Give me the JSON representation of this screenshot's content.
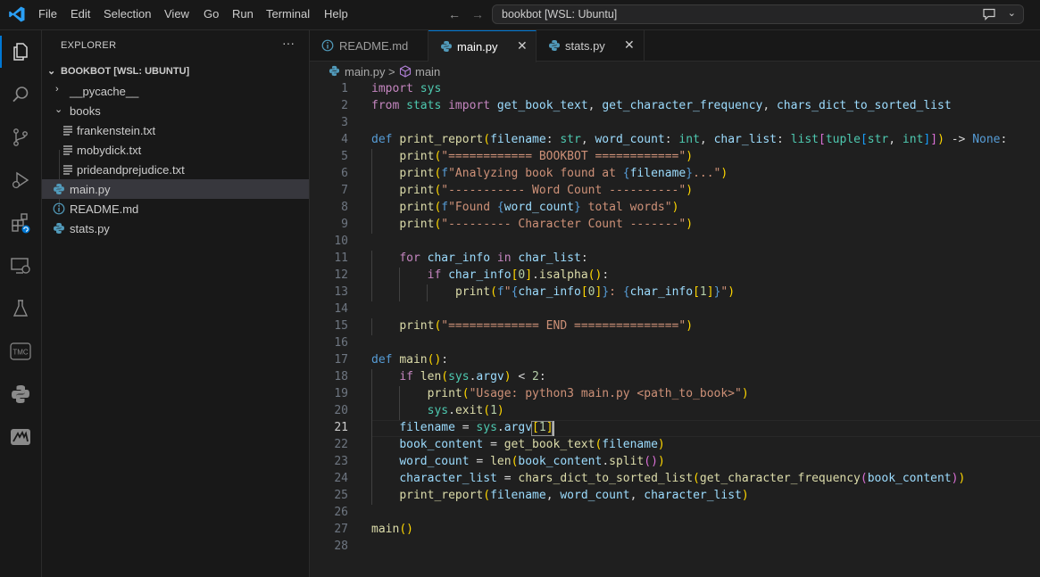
{
  "titlebar": {
    "menu": [
      "File",
      "Edit",
      "Selection",
      "View",
      "Go",
      "Run",
      "Terminal",
      "Help"
    ],
    "command_center": "bookbot [WSL: Ubuntu]"
  },
  "activity_bar": {
    "items": [
      "explorer-icon",
      "search-icon",
      "source-control-icon",
      "run-debug-icon",
      "extensions-icon",
      "remote-explorer-icon",
      "testing-icon",
      "tmc-icon",
      "python-icon",
      "chart-extension-icon"
    ],
    "tmc_label": "TMC"
  },
  "sidebar": {
    "title": "EXPLORER",
    "more": "···",
    "root": "BOOKBOT [WSL: UBUNTU]",
    "tree": [
      {
        "label": "__pycache__",
        "type": "folder",
        "expanded": false
      },
      {
        "label": "books",
        "type": "folder",
        "expanded": true
      },
      {
        "label": "frankenstein.txt",
        "type": "txt"
      },
      {
        "label": "mobydick.txt",
        "type": "txt"
      },
      {
        "label": "prideandprejudice.txt",
        "type": "txt"
      },
      {
        "label": "main.py",
        "type": "python",
        "selected": true
      },
      {
        "label": "README.md",
        "type": "info"
      },
      {
        "label": "stats.py",
        "type": "python"
      }
    ]
  },
  "tabs": [
    {
      "label": "README.md",
      "active": false
    },
    {
      "label": "main.py",
      "active": true
    },
    {
      "label": "stats.py",
      "active": false
    }
  ],
  "breadcrumb": {
    "file": "main.py",
    "separator": ">",
    "symbol": "main"
  },
  "editor": {
    "current_line": 21,
    "lines": [
      "import sys",
      "from stats import get_book_text, get_character_frequency, chars_dict_to_sorted_list",
      "",
      "def print_report(filename: str, word_count: int, char_list: list[tuple[str, int]]) -> None:",
      "    print(\"============ BOOKBOT ============\")",
      "    print(f\"Analyzing book found at {filename}...\")",
      "    print(\"----------- Word Count ----------\")",
      "    print(f\"Found {word_count} total words\")",
      "    print(\"--------- Character Count -------\")",
      "",
      "    for char_info in char_list:",
      "        if char_info[0].isalpha():",
      "            print(f\"{char_info[0]}: {char_info[1]}\")",
      "",
      "    print(\"============= END ===============\")",
      "",
      "def main():",
      "    if len(sys.argv) < 2:",
      "        print(\"Usage: python3 main.py <path_to_book>\")",
      "        sys.exit(1)",
      "    filename = sys.argv[1]",
      "    book_content = get_book_text(filename)",
      "    word_count = len(book_content.split())",
      "    character_list = chars_dict_to_sorted_list(get_character_frequency(book_content))",
      "    print_report(filename, word_count, character_list)",
      "",
      "main()",
      ""
    ]
  },
  "colors": {
    "accent": "#0078d4",
    "keyword": "#c586c0",
    "storage": "#569cd6",
    "string": "#ce9178",
    "function": "#dcdcaa",
    "builtin_type": "#4ec9b0",
    "variable": "#9cdcfe",
    "number": "#b5cea8"
  }
}
